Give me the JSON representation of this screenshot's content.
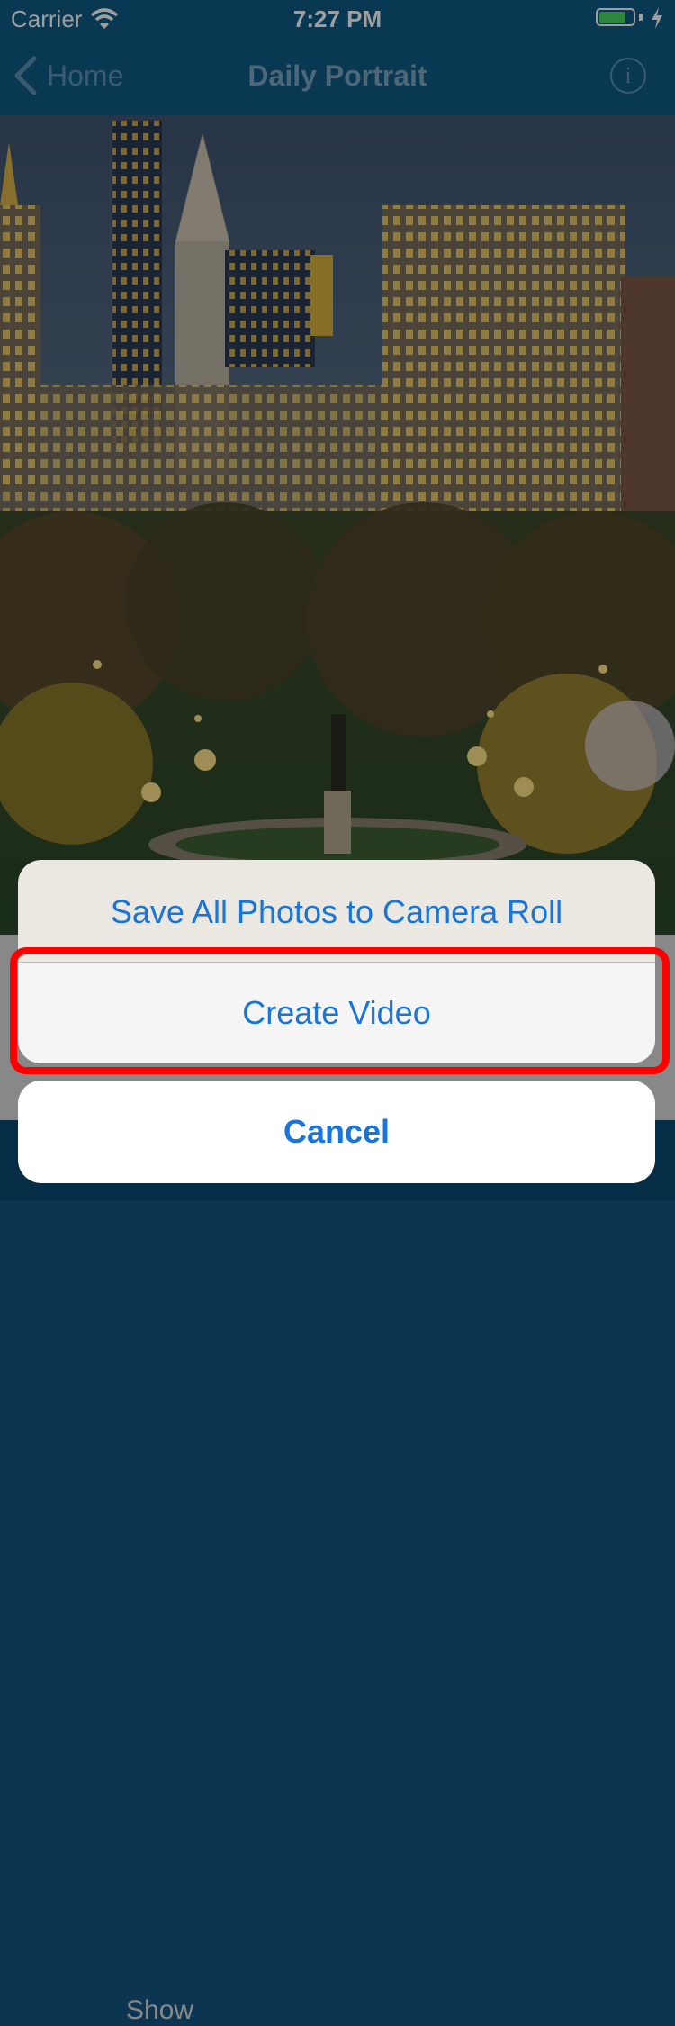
{
  "status_bar": {
    "carrier": "Carrier",
    "time": "7:27 PM",
    "battery_level": 0.8
  },
  "nav": {
    "back_label": "Home",
    "title": "Daily Portrait",
    "info_glyph": "i"
  },
  "photo": {
    "subject": "city-skyline-park-at-dusk"
  },
  "background": {
    "partial_label": "Show"
  },
  "action_sheet": {
    "save_label": "Save All Photos to Camera Roll",
    "create_label": "Create Video",
    "cancel_label": "Cancel",
    "highlighted_action": "Create Video"
  },
  "colors": {
    "nav_bar": "#0f5b87",
    "action_text": "#1a75d9",
    "highlight": "#ff0000",
    "battery": "#4cd964"
  }
}
